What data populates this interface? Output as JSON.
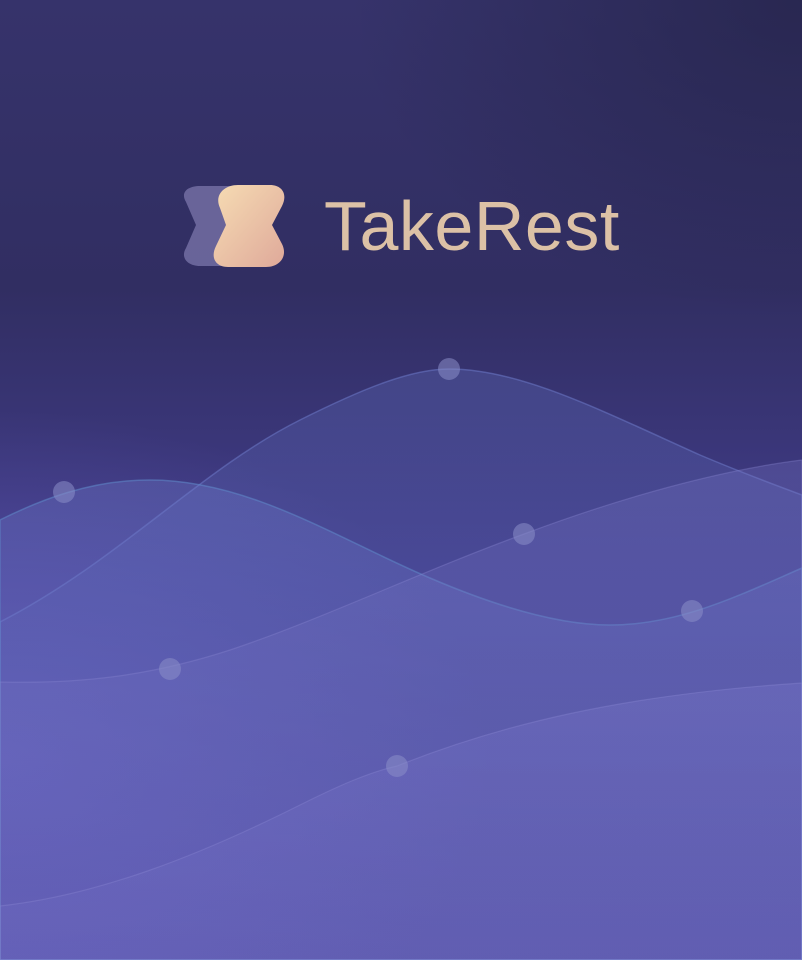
{
  "brand": {
    "name": "TakeRest",
    "logo_icon": "hourglass-logo-icon",
    "text_color": "#dcc1a6",
    "logo_front_colors": [
      "#f4d3ae",
      "#e2b6a0"
    ],
    "logo_back_color": "#6f6a9e"
  },
  "background": {
    "gradient_colors": [
      "#36336b",
      "#262448",
      "#5a55aa"
    ],
    "wave_color": "#6e74c4",
    "dot_color": "#8a8ec8"
  }
}
